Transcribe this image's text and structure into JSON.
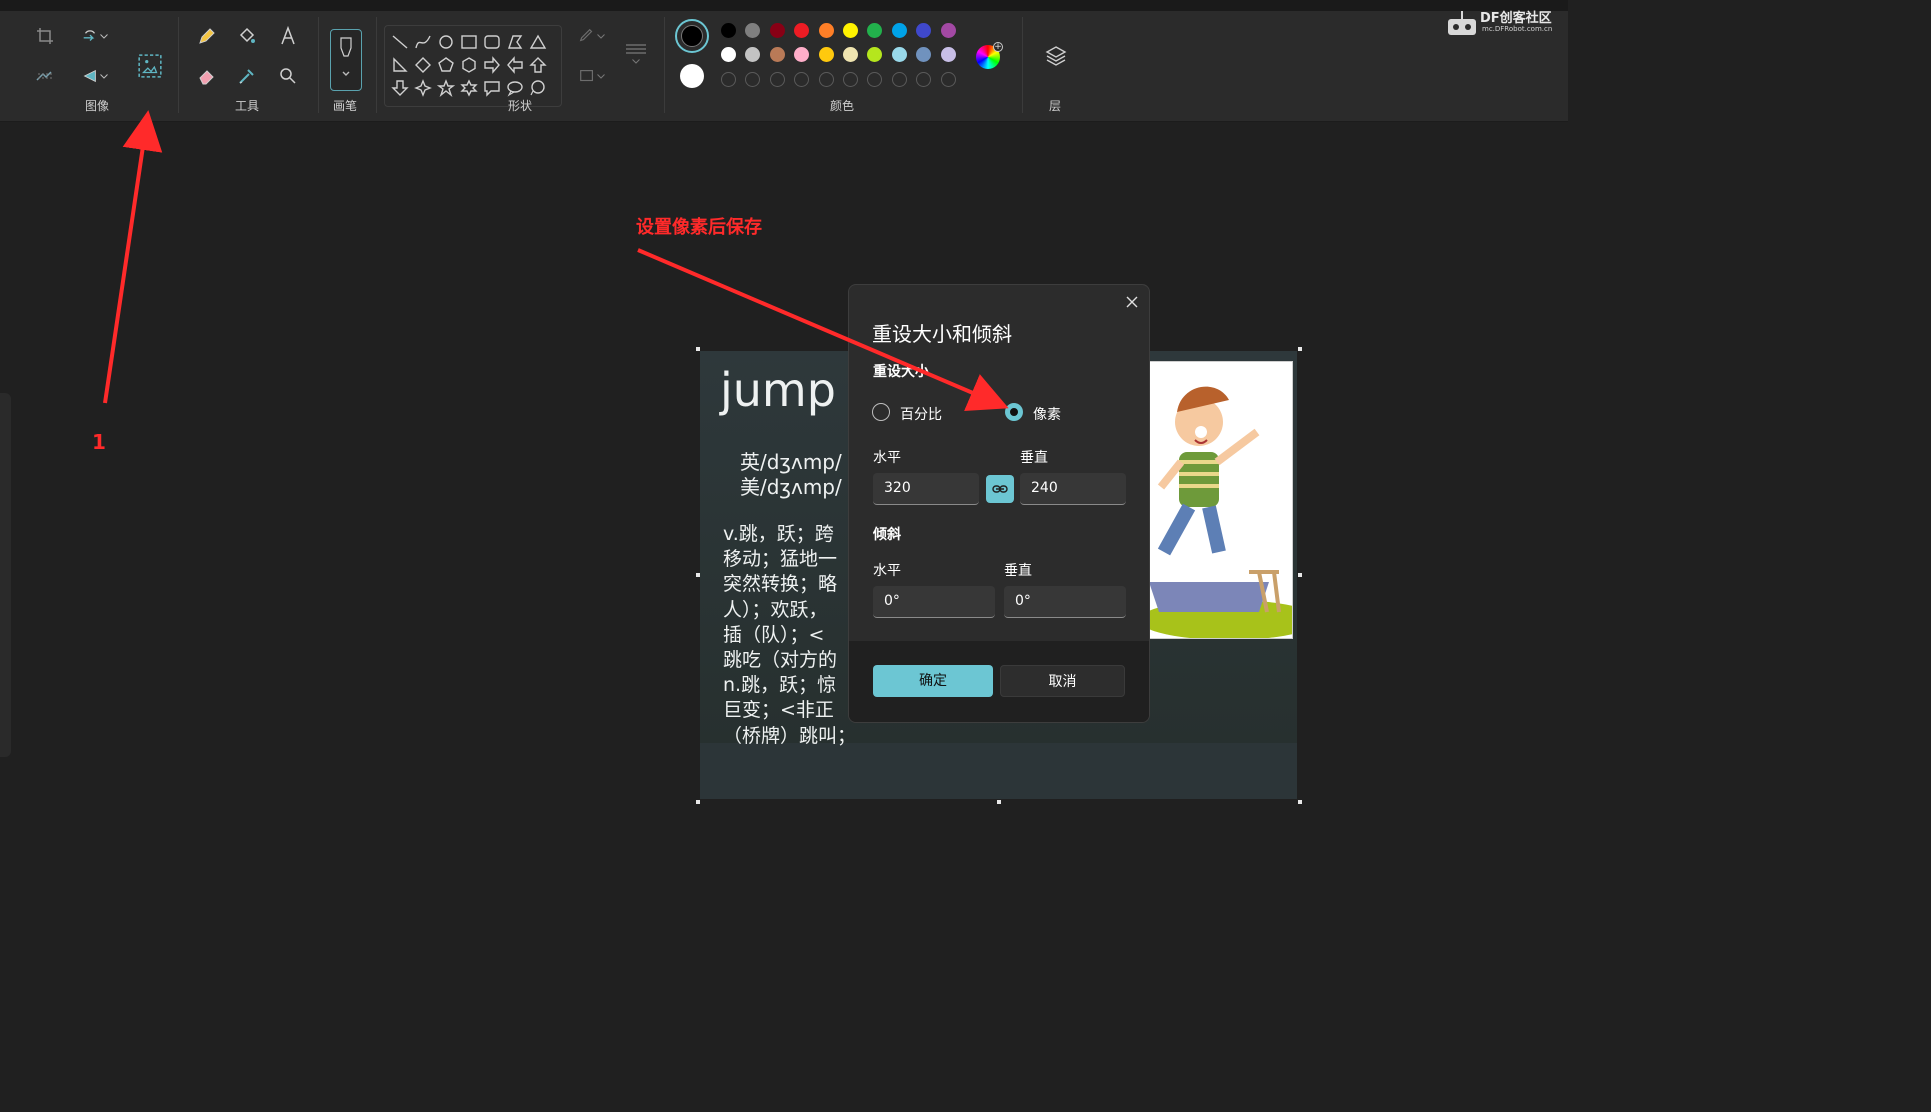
{
  "toolbar": {
    "groups": {
      "image": "图像",
      "tools": "工具",
      "brushes": "画笔",
      "shapes": "形状",
      "colors": "颜色",
      "layers": "层"
    },
    "colors": {
      "row1": [
        "#000000",
        "#7f7f7f",
        "#880015",
        "#ed1c24",
        "#ff7f27",
        "#fff200",
        "#22b14c",
        "#00a2e8",
        "#3f48cc",
        "#a349a4"
      ],
      "row2": [
        "#ffffff",
        "#c3c3c3",
        "#b97a57",
        "#ffaec9",
        "#ffc90e",
        "#efe4b0",
        "#b5e61d",
        "#99d9ea",
        "#7092be",
        "#c8bfe7"
      ],
      "primary": "#000000",
      "secondary": "#ffffff"
    }
  },
  "watermark": {
    "brand": "DF创客社区",
    "url": "mc.DFRobot.com.cn"
  },
  "image_content": {
    "word": "jump",
    "phonetic_uk": "英/dʒʌmp/",
    "phonetic_us": "美/dʒʌmp/",
    "definition_lines": [
      "v.跳，跃；跨",
      "移动；猛地一",
      "突然转换；略",
      "人）；欢跃，",
      "插（队）；<",
      "跳吃（对方的",
      "n.跳，跃；惊",
      "巨变；<非正",
      "（桥牌）跳叫；"
    ]
  },
  "dialog": {
    "title": "重设大小和倾斜",
    "resize_section": "重设大小",
    "option_percent": "百分比",
    "option_pixels": "像素",
    "selected_option": "像素",
    "horizontal_label": "水平",
    "vertical_label": "垂直",
    "width_value": "320",
    "height_value": "240",
    "aspect_lock": true,
    "skew_section": "倾斜",
    "skew_horizontal_label": "水平",
    "skew_vertical_label": "垂直",
    "skew_horizontal_value": "0°",
    "skew_vertical_value": "0°",
    "ok_label": "确定",
    "cancel_label": "取消"
  },
  "annotations": {
    "step_label": "1",
    "instruction": "设置像素后保存",
    "color": "#ff2a2a"
  }
}
